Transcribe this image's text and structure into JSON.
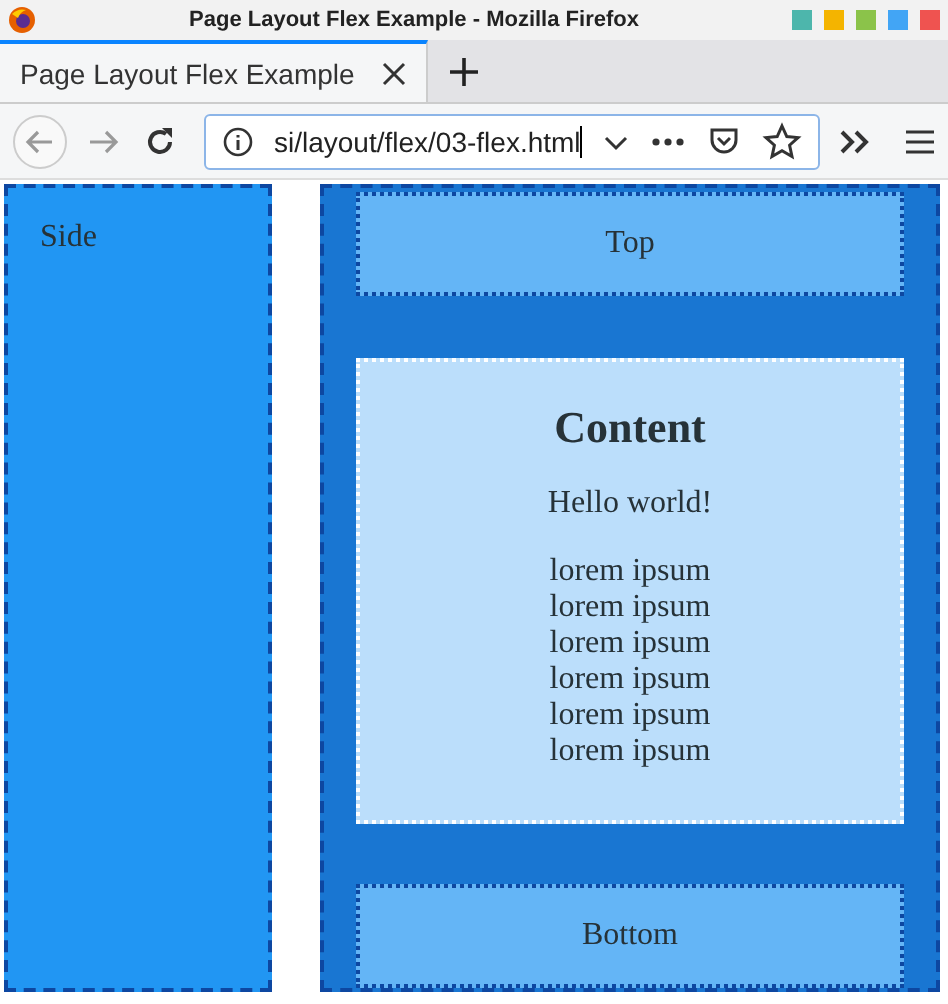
{
  "window": {
    "title": "Page Layout Flex Example - Mozilla Firefox"
  },
  "tabs": [
    {
      "label": "Page Layout Flex Example",
      "selected": true
    }
  ],
  "address_bar": {
    "value": "si/layout/flex/03-flex.html"
  },
  "page": {
    "side": "Side",
    "top": "Top",
    "content": {
      "heading": "Content",
      "paragraph": "Hello world!",
      "lines": [
        "lorem ipsum",
        "lorem ipsum",
        "lorem ipsum",
        "lorem ipsum",
        "lorem ipsum",
        "lorem ipsum"
      ]
    },
    "bottom": "Bottom"
  }
}
